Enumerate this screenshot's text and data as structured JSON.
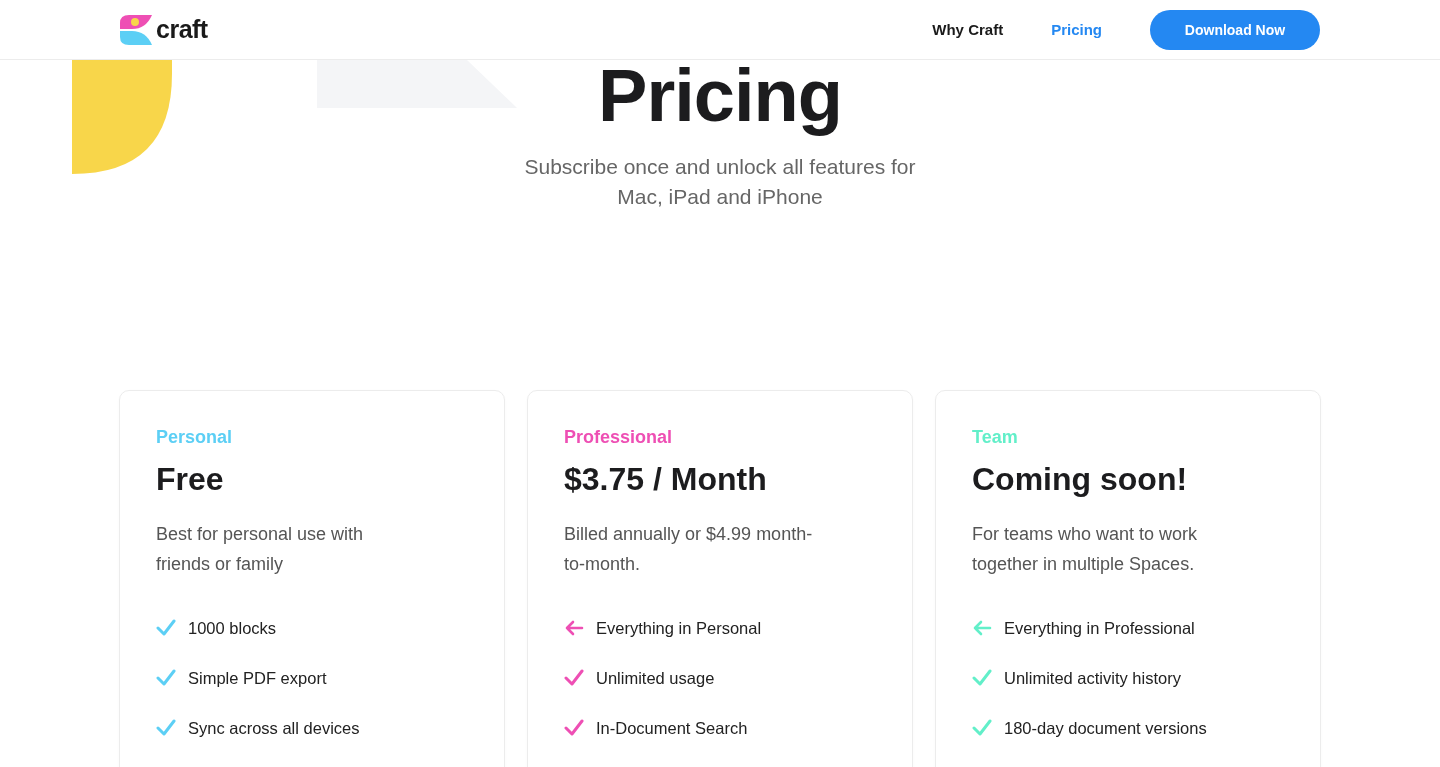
{
  "header": {
    "logo_text": "craft",
    "nav": [
      {
        "label": "Why Craft",
        "selected": false
      },
      {
        "label": "Pricing",
        "selected": true
      }
    ],
    "cta": "Download Now"
  },
  "hero": {
    "title": "Pricing",
    "subtitle": "Subscribe once and unlock all features for Mac, iPad and iPhone"
  },
  "plans": [
    {
      "tier": "Personal",
      "color": "#5ccff5",
      "price": "Free",
      "description": "Best for personal use with friends or family",
      "features": [
        {
          "kind": "check",
          "text": "1000 blocks"
        },
        {
          "kind": "check",
          "text": "Simple PDF export"
        },
        {
          "kind": "check",
          "text": "Sync across all devices"
        }
      ]
    },
    {
      "tier": "Professional",
      "color": "#ee4fb4",
      "price": "$3.75 / Month",
      "description": "Billed annually or $4.99 month-to-month.",
      "features": [
        {
          "kind": "inherit",
          "text": "Everything in Personal"
        },
        {
          "kind": "check",
          "text": "Unlimited usage"
        },
        {
          "kind": "check",
          "text": "In-Document Search"
        }
      ]
    },
    {
      "tier": "Team",
      "color": "#62efc9",
      "price": "Coming soon!",
      "description": "For teams who want to work together in multiple Spaces.",
      "features": [
        {
          "kind": "inherit",
          "text": "Everything in Professional"
        },
        {
          "kind": "check",
          "text": "Unlimited activity history"
        },
        {
          "kind": "check",
          "text": "180-day document versions"
        }
      ]
    }
  ]
}
